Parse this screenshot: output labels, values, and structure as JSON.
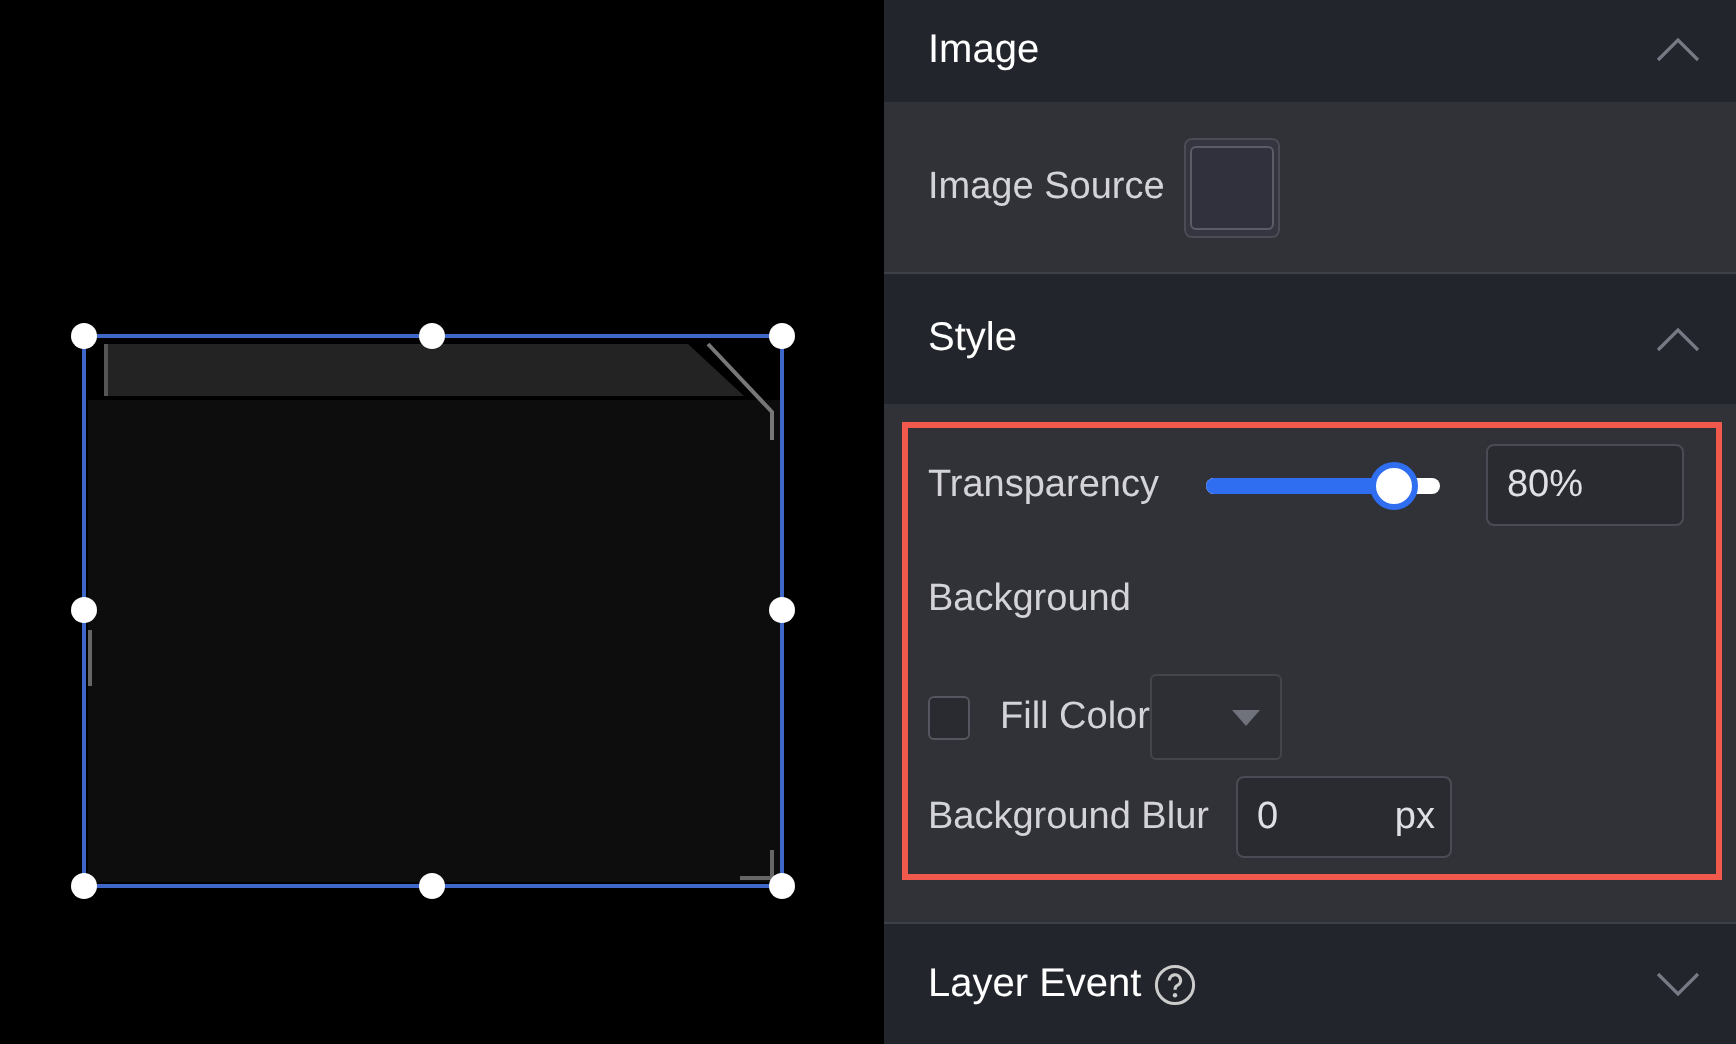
{
  "canvas": {
    "selected": true
  },
  "sections": [
    {
      "kind": "image",
      "title": "Image",
      "expanded": true,
      "image_source_label": "Image Source"
    },
    {
      "kind": "style",
      "title": "Style",
      "expanded": true,
      "highlighted": true,
      "transparency": {
        "label": "Transparency",
        "level": 0.8,
        "value": "80%"
      },
      "background_label": "Background",
      "fill_color": {
        "label": "Fill Color",
        "checked": false
      },
      "blur": {
        "label": "Background Blur",
        "value": "0",
        "unit": "px"
      }
    },
    {
      "kind": "event",
      "title": "Layer Event",
      "expanded": false
    }
  ]
}
